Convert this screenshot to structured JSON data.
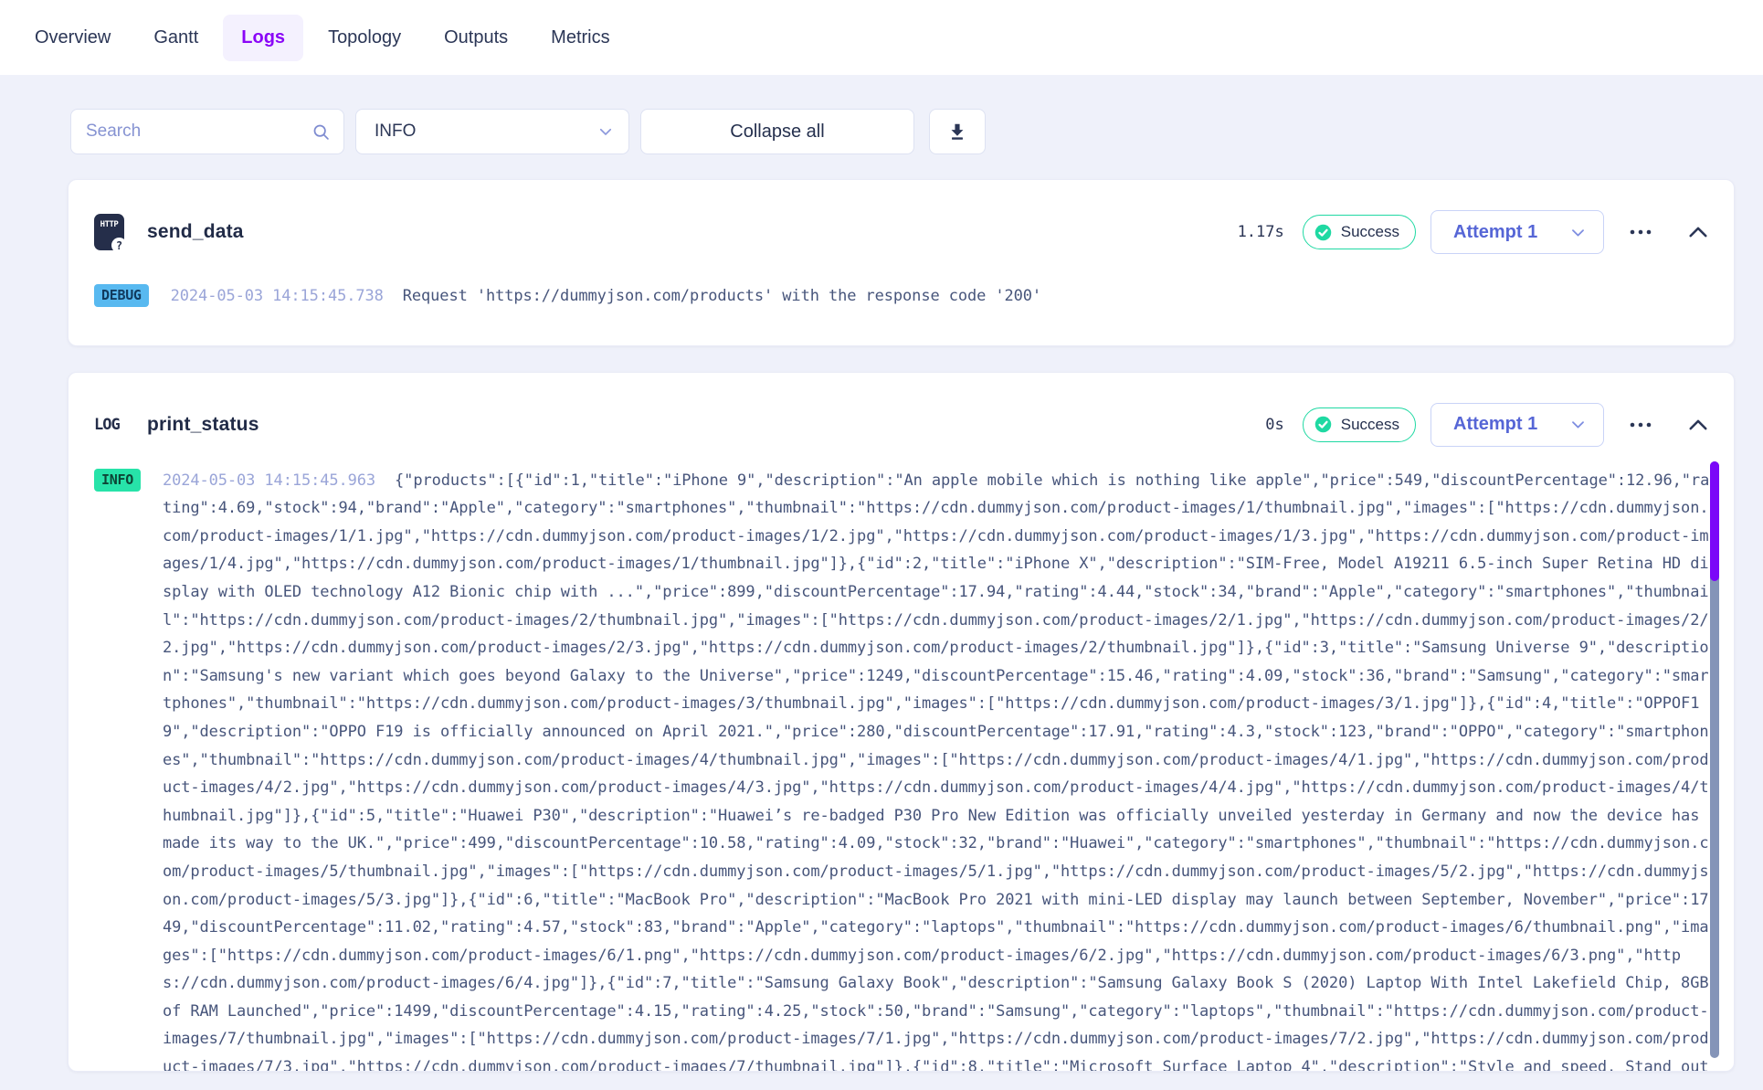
{
  "tabs": [
    {
      "label": "Overview",
      "active": false
    },
    {
      "label": "Gantt",
      "active": false
    },
    {
      "label": "Logs",
      "active": true
    },
    {
      "label": "Topology",
      "active": false
    },
    {
      "label": "Outputs",
      "active": false
    },
    {
      "label": "Metrics",
      "active": false
    }
  ],
  "controls": {
    "search_placeholder": "Search",
    "search_icon": "search-icon",
    "level_filter_value": "INFO",
    "level_filter_chevron": "chevron-down-icon",
    "collapse_all_label": "Collapse all",
    "download_icon": "download-icon"
  },
  "colors": {
    "accent_purple": "#8A06F7",
    "active_tab_bg": "#F4F1FE",
    "page_bg": "#EFF1FA",
    "success_green": "#20D9A3",
    "debug_badge_bg": "#58B9F0",
    "info_badge_bg": "#27E3A9",
    "timestamp": "#9AA5D8",
    "log_text": "#47557B",
    "scroll_thumb": "#7B08F8",
    "scroll_track": "#8494B8"
  },
  "entries": [
    {
      "icon": "http-task-icon",
      "icon_label": "HTTP",
      "icon_sub": "?",
      "title": "send_data",
      "duration": "1.17s",
      "status": "Success",
      "attempt_label": "Attempt 1",
      "log": {
        "level": "DEBUG",
        "timestamp": "2024-05-03 14:15:45.738",
        "message": "Request 'https://dummyjson.com/products' with the response code '200'"
      }
    },
    {
      "icon": "log-task-icon",
      "icon_label": "LOG",
      "title": "print_status",
      "duration": "0s",
      "status": "Success",
      "attempt_label": "Attempt 1",
      "log": {
        "level": "INFO",
        "timestamp": "2024-05-03 14:15:45.963",
        "message": "{\"products\":[{\"id\":1,\"title\":\"iPhone 9\",\"description\":\"An apple mobile which is nothing like apple\",\"price\":549,\"discountPercentage\":12.96,\"rating\":4.69,\"stock\":94,\"brand\":\"Apple\",\"category\":\"smartphones\",\"thumbnail\":\"https://cdn.dummyjson.com/product-images/1/thumbnail.jpg\",\"images\":[\"https://cdn.dummyjson.com/product-images/1/1.jpg\",\"https://cdn.dummyjson.com/product-images/1/2.jpg\",\"https://cdn.dummyjson.com/product-images/1/3.jpg\",\"https://cdn.dummyjson.com/product-images/1/4.jpg\",\"https://cdn.dummyjson.com/product-images/1/thumbnail.jpg\"]},{\"id\":2,\"title\":\"iPhone X\",\"description\":\"SIM-Free, Model A19211 6.5-inch Super Retina HD display with OLED technology A12 Bionic chip with ...\",\"price\":899,\"discountPercentage\":17.94,\"rating\":4.44,\"stock\":34,\"brand\":\"Apple\",\"category\":\"smartphones\",\"thumbnail\":\"https://cdn.dummyjson.com/product-images/2/thumbnail.jpg\",\"images\":[\"https://cdn.dummyjson.com/product-images/2/1.jpg\",\"https://cdn.dummyjson.com/product-images/2/2.jpg\",\"https://cdn.dummyjson.com/product-images/2/3.jpg\",\"https://cdn.dummyjson.com/product-images/2/thumbnail.jpg\"]},{\"id\":3,\"title\":\"Samsung Universe 9\",\"description\":\"Samsung's new variant which goes beyond Galaxy to the Universe\",\"price\":1249,\"discountPercentage\":15.46,\"rating\":4.09,\"stock\":36,\"brand\":\"Samsung\",\"category\":\"smartphones\",\"thumbnail\":\"https://cdn.dummyjson.com/product-images/3/thumbnail.jpg\",\"images\":[\"https://cdn.dummyjson.com/product-images/3/1.jpg\"]},{\"id\":4,\"title\":\"OPPOF19\",\"description\":\"OPPO F19 is officially announced on April 2021.\",\"price\":280,\"discountPercentage\":17.91,\"rating\":4.3,\"stock\":123,\"brand\":\"OPPO\",\"category\":\"smartphones\",\"thumbnail\":\"https://cdn.dummyjson.com/product-images/4/thumbnail.jpg\",\"images\":[\"https://cdn.dummyjson.com/product-images/4/1.jpg\",\"https://cdn.dummyjson.com/product-images/4/2.jpg\",\"https://cdn.dummyjson.com/product-images/4/3.jpg\",\"https://cdn.dummyjson.com/product-images/4/4.jpg\",\"https://cdn.dummyjson.com/product-images/4/thumbnail.jpg\"]},{\"id\":5,\"title\":\"Huawei P30\",\"description\":\"Huawei’s re-badged P30 Pro New Edition was officially unveiled yesterday in Germany and now the device has made its way to the UK.\",\"price\":499,\"discountPercentage\":10.58,\"rating\":4.09,\"stock\":32,\"brand\":\"Huawei\",\"category\":\"smartphones\",\"thumbnail\":\"https://cdn.dummyjson.com/product-images/5/thumbnail.jpg\",\"images\":[\"https://cdn.dummyjson.com/product-images/5/1.jpg\",\"https://cdn.dummyjson.com/product-images/5/2.jpg\",\"https://cdn.dummyjson.com/product-images/5/3.jpg\"]},{\"id\":6,\"title\":\"MacBook Pro\",\"description\":\"MacBook Pro 2021 with mini-LED display may launch between September, November\",\"price\":1749,\"discountPercentage\":11.02,\"rating\":4.57,\"stock\":83,\"brand\":\"Apple\",\"category\":\"laptops\",\"thumbnail\":\"https://cdn.dummyjson.com/product-images/6/thumbnail.png\",\"images\":[\"https://cdn.dummyjson.com/product-images/6/1.png\",\"https://cdn.dummyjson.com/product-images/6/2.jpg\",\"https://cdn.dummyjson.com/product-images/6/3.png\",\"https://cdn.dummyjson.com/product-images/6/4.jpg\"]},{\"id\":7,\"title\":\"Samsung Galaxy Book\",\"description\":\"Samsung Galaxy Book S (2020) Laptop With Intel Lakefield Chip, 8GB of RAM Launched\",\"price\":1499,\"discountPercentage\":4.15,\"rating\":4.25,\"stock\":50,\"brand\":\"Samsung\",\"category\":\"laptops\",\"thumbnail\":\"https://cdn.dummyjson.com/product-images/7/thumbnail.jpg\",\"images\":[\"https://cdn.dummyjson.com/product-images/7/1.jpg\",\"https://cdn.dummyjson.com/product-images/7/2.jpg\",\"https://cdn.dummyjson.com/product-images/7/3.jpg\",\"https://cdn.dummyjson.com/product-images/7/thumbnail.jpg\"]},{\"id\":8,\"title\":\"Microsoft Surface Laptop 4\",\"description\":\"Style and speed. Stand out"
      }
    }
  ]
}
